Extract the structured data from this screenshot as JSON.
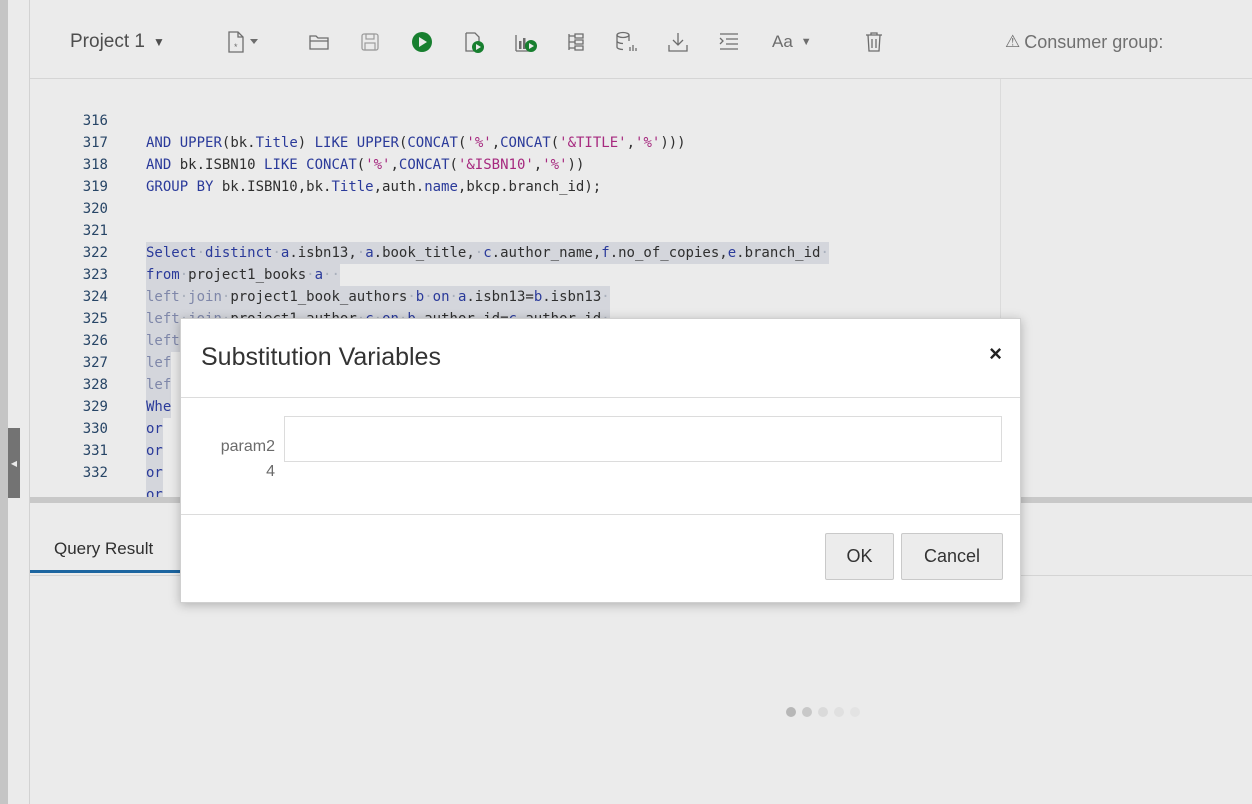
{
  "toolbar": {
    "project_label": "Project 1",
    "consumer_group_label": "Consumer group:",
    "icons": [
      "new-file-icon",
      "open-folder-icon",
      "save-icon",
      "run-icon",
      "run-script-icon",
      "explain-plan-icon",
      "autotrace-icon",
      "sql-tuning-icon",
      "download-icon",
      "format-icon",
      "font-case-icon",
      "delete-icon"
    ]
  },
  "editor": {
    "lines": [
      {
        "n": "316",
        "text": "AND UPPER(bk.Title) LIKE UPPER(CONCAT('%',CONCAT('&TITLE','%')))"
      },
      {
        "n": "317",
        "text": "AND bk.ISBN10 LIKE CONCAT('%',CONCAT('&ISBN10','%'))"
      },
      {
        "n": "318",
        "text": "GROUP BY bk.ISBN10,bk.Title,auth.name,bkcp.branch_id);"
      },
      {
        "n": "319",
        "text": ""
      },
      {
        "n": "320",
        "text": ""
      },
      {
        "n": "321",
        "text": "Select distinct a.isbn13, a.book_title, c.author_name,f.no_of_copies,e.branch_id"
      },
      {
        "n": "322",
        "text": "from project1_books a"
      },
      {
        "n": "323",
        "text": "left join project1_book_authors b on a.isbn13=b.isbn13"
      },
      {
        "n": "324",
        "text": "left join project1_author c on b.author_id=c.author_id"
      },
      {
        "n": "325",
        "text": "left join project1_book_copies d on b.isbn13=d.isbn"
      },
      {
        "n": "326",
        "text": "lef"
      },
      {
        "n": "327",
        "text": "lef"
      },
      {
        "n": "328",
        "text": "Whe"
      },
      {
        "n": "329",
        "text": "or"
      },
      {
        "n": "330",
        "text": "or"
      },
      {
        "n": "331",
        "text": "or"
      },
      {
        "n": "332",
        "text": "or"
      }
    ]
  },
  "results": {
    "tab_label": "Query Result"
  },
  "dialog": {
    "title": "Substitution Variables",
    "close_label": "×",
    "param_label": "param2\n4",
    "param_value": "",
    "ok_label": "OK",
    "cancel_label": "Cancel"
  }
}
